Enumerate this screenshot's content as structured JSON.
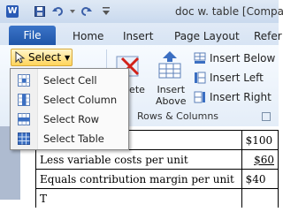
{
  "titlebar": {
    "app_icon_letter": "W",
    "title": "doc w. table [Compati"
  },
  "tabs": {
    "file": "File",
    "items": [
      "Home",
      "Insert",
      "Page Layout",
      "Refer"
    ]
  },
  "ribbon": {
    "select_label": "Select",
    "delete_label": "lete",
    "insert_above_label_1": "Insert",
    "insert_above_label_2": "Above",
    "insert_below": "Insert Below",
    "insert_left": "Insert Left",
    "insert_right": "Insert Right",
    "rows_columns_label": "Rows & Columns"
  },
  "menu": {
    "items": [
      "Select Cell",
      "Select Column",
      "Select Row",
      "Select Table"
    ]
  },
  "table": {
    "rows": [
      {
        "label": "",
        "value": "$100"
      },
      {
        "label": "Less variable costs per unit",
        "value": "$60"
      },
      {
        "label": "Equals contribution margin per unit",
        "value": "$40"
      },
      {
        "label": "T",
        "value": ""
      }
    ]
  },
  "colors": {
    "accent": "#2a5bb5",
    "select_highlight": "#ffd45a"
  }
}
